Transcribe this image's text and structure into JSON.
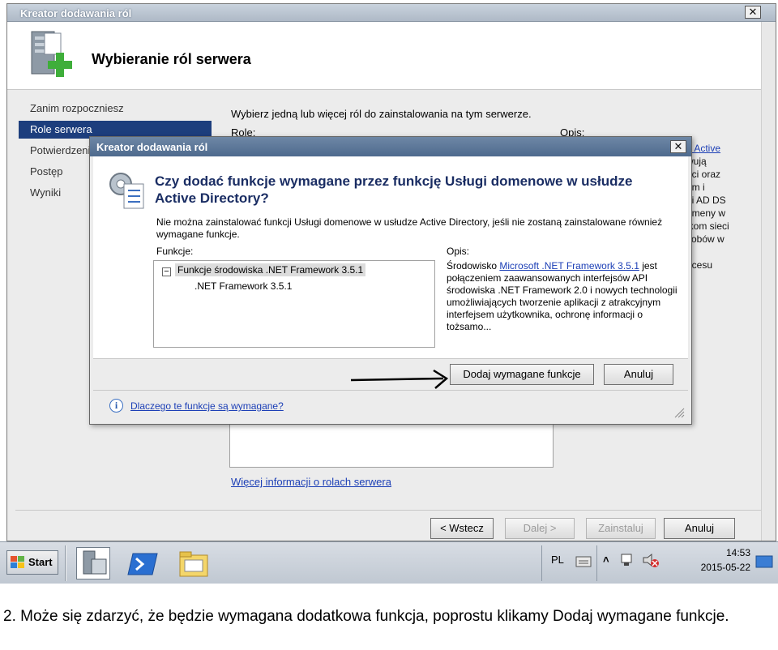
{
  "wizard": {
    "title": "Kreator dodawania ról",
    "heading": "Wybieranie ról serwera",
    "nav": [
      "Zanim rozpoczniesz",
      "Role serwera",
      "Potwierdzeni",
      "Postęp",
      "Wyniki"
    ],
    "instruction": "Wybierz jedną lub więcej ról do zainstalowania na tym serwerze.",
    "col_role": "Role:",
    "col_desc": "Opis:",
    "side_fragment": [
      "e Active",
      "wują",
      "eci oraz",
      "om i",
      "gi AD DS",
      "omeny w",
      "ikom sieci",
      "sobów w",
      "",
      "ocesu"
    ],
    "more_info_link": "Więcej informacji o rolach serwera",
    "buttons": {
      "back": "< Wstecz",
      "next": "Dalej >",
      "install": "Zainstaluj",
      "cancel": "Anuluj"
    }
  },
  "dialog": {
    "title": "Kreator dodawania ról",
    "question": "Czy dodać funkcje wymagane przez funkcję Usługi domenowe w usłudze Active Directory?",
    "message": "Nie można zainstalować funkcji Usługi domenowe w usłudze Active Directory, jeśli nie zostaną zainstalowane również wymagane funkcje.",
    "features_label": "Funkcje:",
    "desc_label": "Opis:",
    "feature_parent": "Funkcje środowiska .NET Framework 3.5.1",
    "feature_child": ".NET Framework 3.5.1",
    "description_prefix": "Środowisko ",
    "description_link": "Microsoft .NET Framework 3.5.1",
    "description_rest": " jest połączeniem zaawansowanych interfejsów API środowiska .NET Framework 2.0 i nowych technologii umożliwiających tworzenie aplikacji z atrakcyjnym interfejsem użytkownika, ochronę informacji o tożsamo...",
    "add_button": "Dodaj wymagane funkcje",
    "cancel_button": "Anuluj",
    "help_link": "Dlaczego te funkcje są wymagane?"
  },
  "taskbar": {
    "start": "Start",
    "lang": "PL",
    "time": "14:53",
    "date": "2015-05-22"
  },
  "caption": "2. Może się zdarzyć, że będzie wymagana dodatkowa funkcja, poprostu klikamy Dodaj wymagane funkcje."
}
